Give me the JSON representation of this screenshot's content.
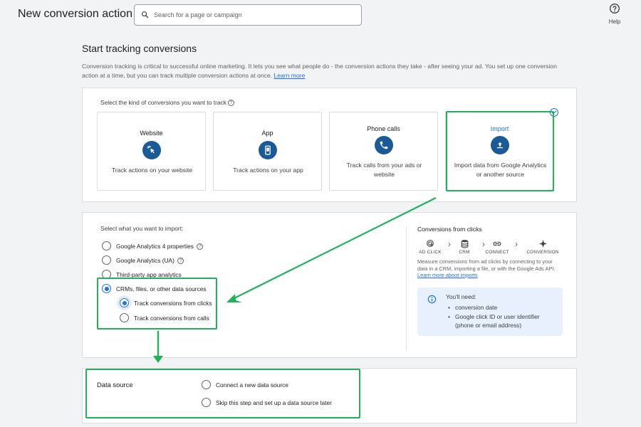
{
  "header": {
    "title": "New conversion action",
    "search_placeholder": "Search for a page or campaign",
    "help_label": "Help"
  },
  "intro": {
    "title": "Start tracking conversions",
    "text": "Conversion tracking is critical to successful online marketing. It lets you see what people do - the conversion actions they take - after seeing your ad. You set up one conversion action at a time, but you can track multiple conversion actions at once.",
    "learn_more": "Learn more"
  },
  "kinds": {
    "prompt": "Select the kind of conversions you want to track",
    "selected": "Import",
    "tiles": [
      {
        "name": "Website",
        "desc": "Track actions on your website",
        "icon": "cursor-click-icon"
      },
      {
        "name": "App",
        "desc": "Track actions on your app",
        "icon": "smartphone-icon"
      },
      {
        "name": "Phone calls",
        "desc": "Track calls from your ads or website",
        "icon": "phone-icon"
      },
      {
        "name": "Import",
        "desc": "Import data from Google Analytics or another source",
        "icon": "upload-icon"
      }
    ]
  },
  "import": {
    "prompt": "Select what you want to import:",
    "options": [
      {
        "label": "Google Analytics 4 properties",
        "selected": false
      },
      {
        "label": "Google Analytics (UA)",
        "selected": false
      },
      {
        "label": "Third-party app analytics",
        "selected": false
      },
      {
        "label": "CRMs, files, or other data sources",
        "selected": true
      }
    ],
    "sub_options": [
      {
        "label": "Track conversions from clicks",
        "selected": true
      },
      {
        "label": "Track conversions from calls",
        "selected": false
      }
    ]
  },
  "conversions_from_clicks": {
    "title": "Conversions from clicks",
    "steps": [
      "AD CLICK",
      "CRM",
      "CONNECT",
      "CONVERSION"
    ],
    "desc": "Measure conversions from ad clicks by connecting to your data in a CRM, importing a file, or with the Google Ads API.",
    "learn_more": "Learn more about imports",
    "need_title": "You'll need:",
    "needs": [
      "conversion date",
      "Google click ID or user identifier (phone or email address)"
    ]
  },
  "data_source": {
    "title": "Data source",
    "options": [
      {
        "label": "Connect a new data source",
        "selected": false
      },
      {
        "label": "Skip this step and set up a data source later",
        "selected": false
      }
    ]
  },
  "colors": {
    "accent": "#1a73e8",
    "icon_circle": "#1a5a96",
    "highlight": "#1fb25a",
    "info_box": "#e8f0fe"
  }
}
